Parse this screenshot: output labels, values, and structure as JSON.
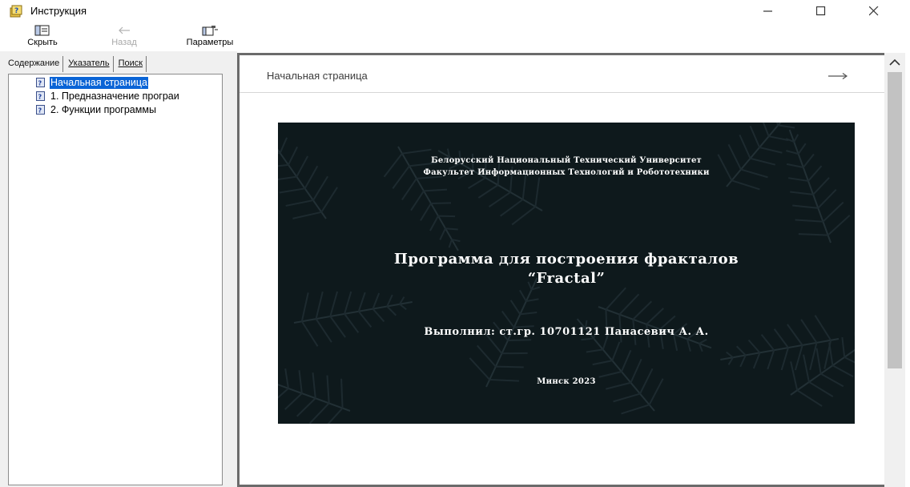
{
  "window": {
    "title": "Инструкция",
    "controls": [
      "minimize",
      "maximize",
      "close"
    ]
  },
  "toolbar": {
    "hide_label": "Скрыть",
    "back_label": "Назад",
    "options_label": "Параметры"
  },
  "nav": {
    "tabs": [
      {
        "label": "Содержание",
        "active": true
      },
      {
        "label": "Указатель",
        "active": false
      },
      {
        "label": "Поиск",
        "active": false
      }
    ],
    "items": [
      {
        "label": "Начальная страница",
        "selected": true
      },
      {
        "label": "1. Предназначение прогрaи",
        "selected": false
      },
      {
        "label": "2. Функции программы",
        "selected": false
      }
    ]
  },
  "content": {
    "heading": "Начальная страница",
    "next_icon": "arrow-right-icon"
  },
  "title_slide": {
    "university": "Белорусский Национальный Технический Университет",
    "faculty": "Факультет Информационных Технологий и Робототехники",
    "program_title": "Программа для построения фракталов",
    "program_name": "“Fractal”",
    "author": "Выполнил: ст.гр. 10701121 Панасевич А. А.",
    "city_year": "Минск 2023"
  },
  "colors": {
    "selection": "#0a64d6",
    "slide_background": "#0f191d",
    "pane_background": "#f0f0f0",
    "frame_border": "#6b6b6b"
  }
}
